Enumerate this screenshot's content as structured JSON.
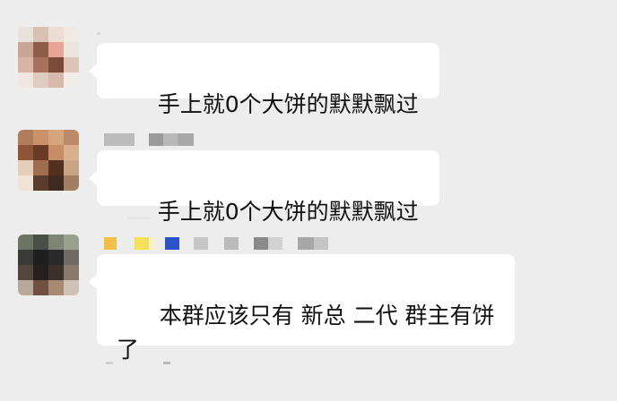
{
  "chat": {
    "messages": [
      {
        "sender": "",
        "text": "手上就0个大饼的默默飘过"
      },
      {
        "sender": "",
        "text": "手上就0个大饼的默默飘过"
      },
      {
        "sender": "",
        "text": "本群应该只有 新总 二代 群主有饼\n了"
      }
    ]
  },
  "colors": {
    "background": "#ededed",
    "bubble": "#ffffff",
    "text": "#111111"
  }
}
